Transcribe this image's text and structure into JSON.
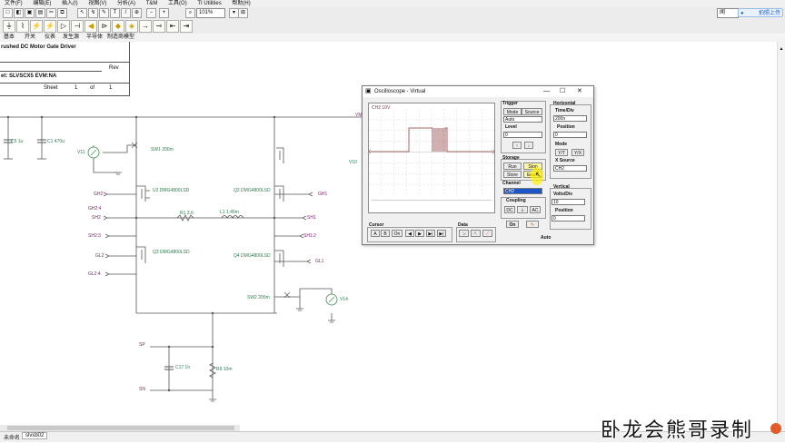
{
  "menubar": {
    "items": [
      "文件(F)",
      "编辑(E)",
      "插入(I)",
      "视图(V)",
      "分析(A)",
      "T&M",
      "工具(O)",
      "TI Utilities",
      "帮助(H)"
    ]
  },
  "toolbar": {
    "zoom_value": "101%",
    "search_value": "闻",
    "upload_label": "拍照上传"
  },
  "component_tabs": [
    "基本",
    "开关",
    "仪表",
    "发生源",
    "半导体",
    "制造商模型"
  ],
  "title_block": {
    "title": "rushed DC Motor Gate Driver",
    "rev_label": "Rev",
    "sheet_id": "et: SLVSCX5  EVM:NA",
    "sheet_label": "Sheet",
    "sheet_num": "1",
    "of_label": "of",
    "sheet_total": "1"
  },
  "schematic": {
    "components": {
      "c5": "C5 1u",
      "c1": "C1 470u",
      "v11": "V11",
      "sw1": "SW1 200m",
      "u2": "U2 DMG4800LSD",
      "q2": "Q2 DMG4800LSD",
      "r1": "R1 3.6",
      "l1": "L1 1.45m",
      "q3": "Q3 DMG4800LSD",
      "q4": "Q4 DMG4800LSD",
      "sw2": "SW2 200m",
      "v14": "V14",
      "v10": "V10",
      "c17": "C17 1n",
      "r9": "R9 10m"
    },
    "nets": {
      "gh2": "GH2",
      "gh24": "GH2:4",
      "sh2": "SH2",
      "sh23": "SH2:3",
      "gl2": "GL2",
      "gl24": "GL2:4",
      "gh1": "GH1",
      "sh1": "SH1",
      "sh12": "SH1:2",
      "gl1": "GL1",
      "sp": "SP",
      "sn": "SN",
      "vm": "VM"
    }
  },
  "oscilloscope": {
    "title": "Oscilloscope - Virtual",
    "trace_label": "CH2 10V",
    "cursor_section": "Cursor",
    "cursor_buttons": [
      "A",
      "B",
      "On",
      "◀",
      "▶",
      "▶|"
    ],
    "data_section": "Data",
    "trigger": {
      "section": "Trigger",
      "mode_label": "Mode",
      "source_label": "Source",
      "mode_value": "Auto",
      "level_label": "Level",
      "level_value": "0"
    },
    "horizontal": {
      "section": "Horizontal",
      "time_label": "Time/Div",
      "time_value": "200n",
      "position_label": "Position",
      "position_value": "0",
      "mode_label": "Mode",
      "mode_opts": [
        "Y/T",
        "Y/X"
      ],
      "x_source_label": "X Source",
      "x_source_value": "CH2"
    },
    "storage": {
      "section": "Storage",
      "run": "Run",
      "stop": "Stop",
      "store": "Store",
      "erase": "Erase"
    },
    "channel": {
      "section": "Channel",
      "value": "CH2",
      "coupling_label": "Coupling",
      "dc": "DC",
      "ac": "AC",
      "on": "On"
    },
    "vertical": {
      "section": "Vertical",
      "volts_label": "Volts/Div",
      "volts_value": "10",
      "position_label": "Position",
      "position_value": "0"
    },
    "auto_label": "Auto"
  },
  "statusbar": {
    "tab1": "未命名",
    "tab2": "slvsb02"
  },
  "watermark": "卧龙会熊哥录制",
  "colors": {
    "wire": "#555555",
    "trace": "#8a3a3a",
    "component_label": "#2c7b4c",
    "net_label": "#7a1f6b"
  }
}
